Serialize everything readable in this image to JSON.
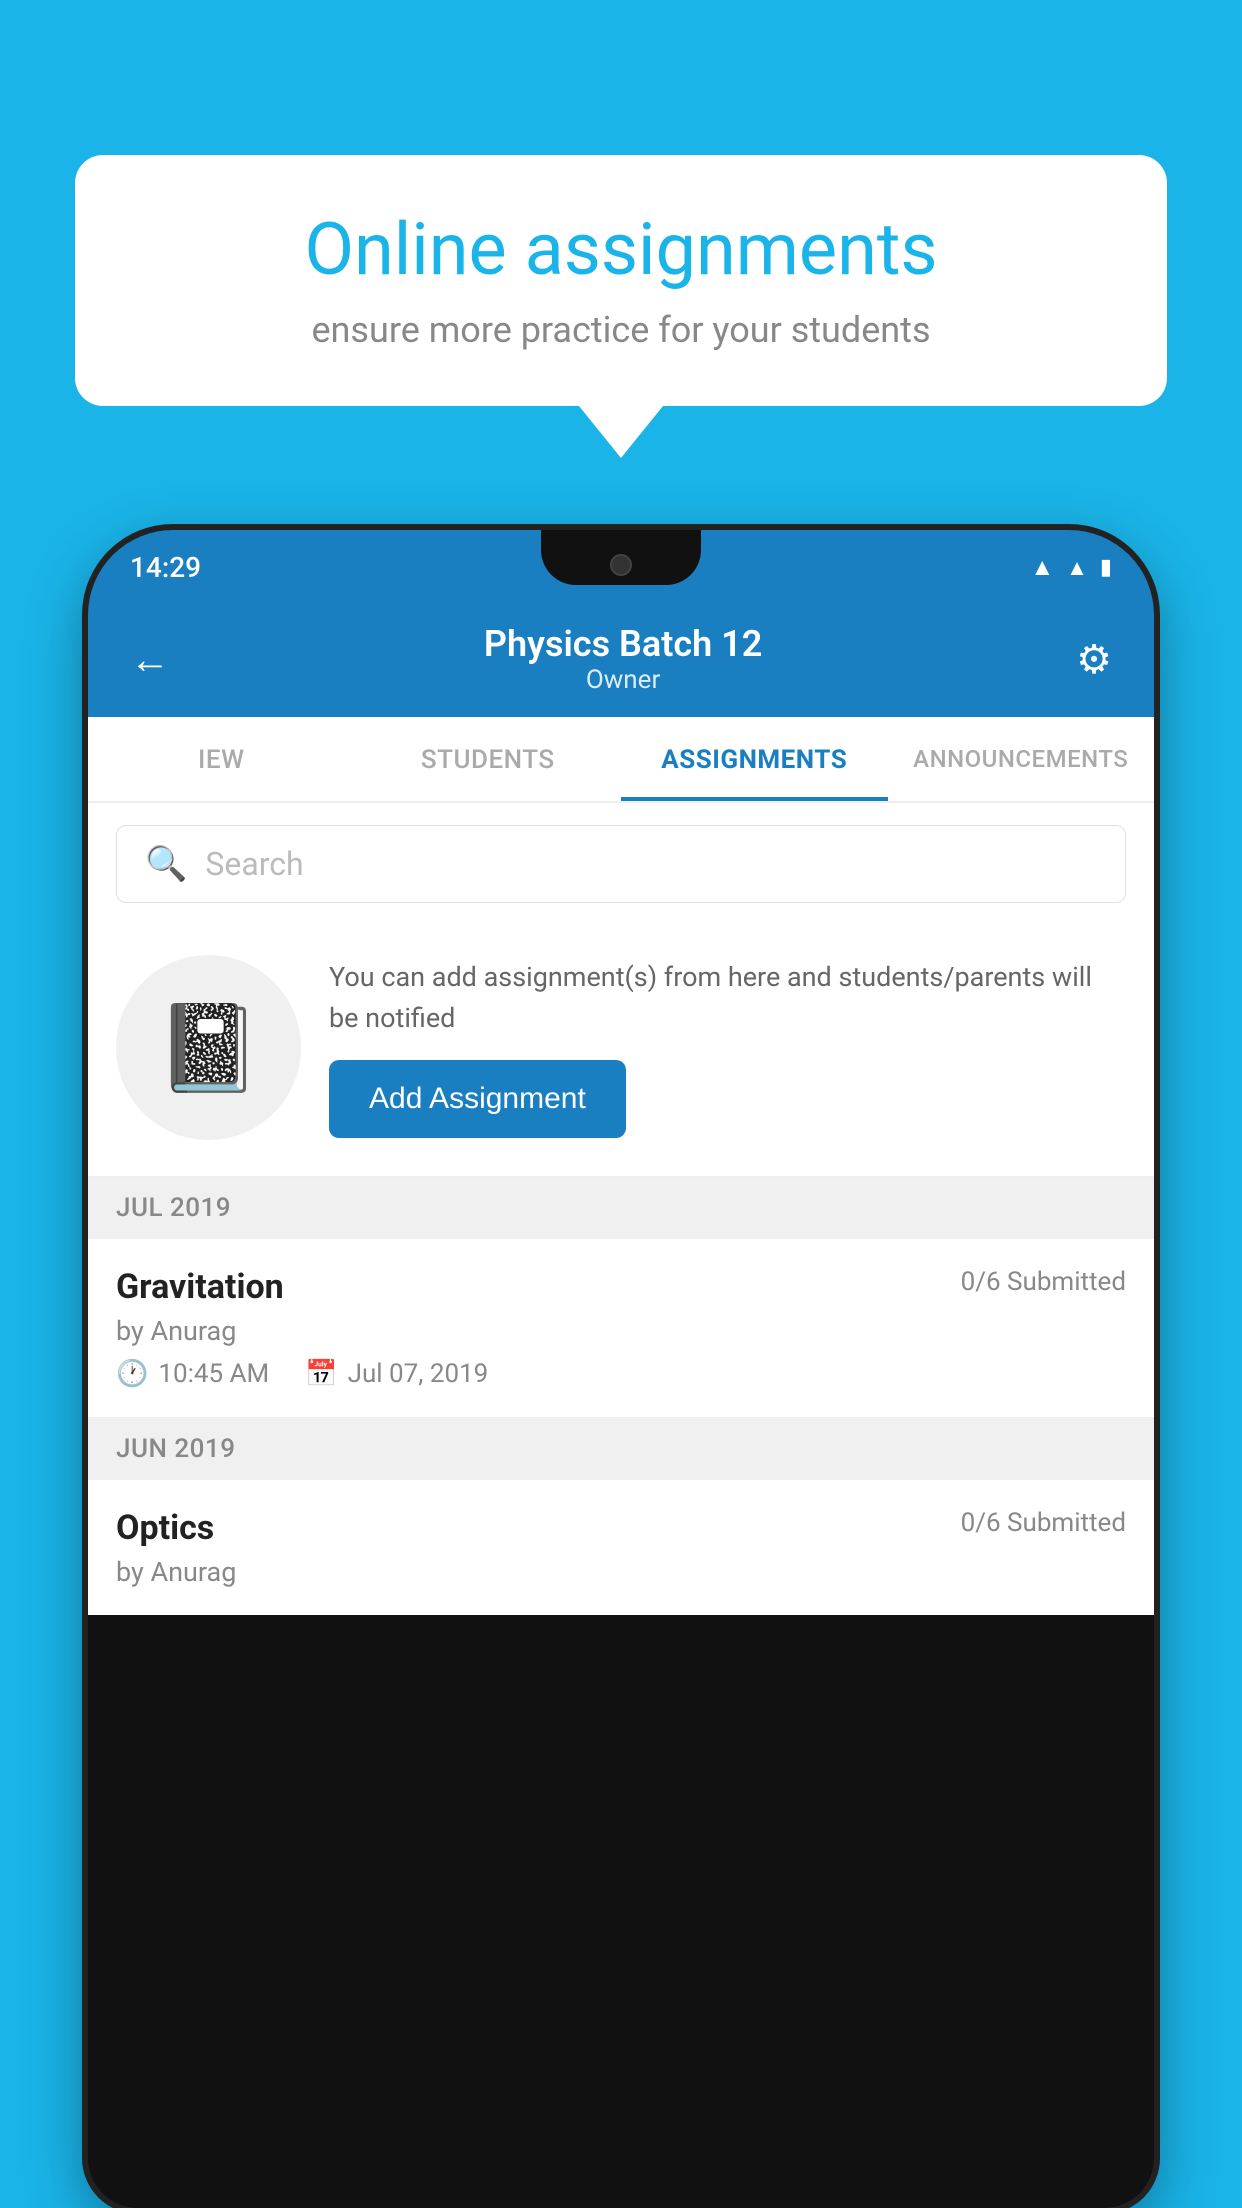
{
  "background": {
    "color": "#1ab4e8"
  },
  "speech_bubble": {
    "title": "Online assignments",
    "subtitle": "ensure more practice for your students"
  },
  "status_bar": {
    "time": "14:29",
    "icons": [
      "wifi",
      "signal",
      "battery"
    ]
  },
  "header": {
    "title": "Physics Batch 12",
    "subtitle": "Owner",
    "back_label": "←",
    "settings_icon": "⚙"
  },
  "tabs": [
    {
      "label": "IEW",
      "active": false
    },
    {
      "label": "STUDENTS",
      "active": false
    },
    {
      "label": "ASSIGNMENTS",
      "active": true
    },
    {
      "label": "ANNOUNCEMENTS",
      "active": false
    }
  ],
  "search": {
    "placeholder": "Search",
    "icon": "🔍"
  },
  "promo": {
    "description": "You can add assignment(s) from here and students/parents will be notified",
    "button_label": "Add Assignment"
  },
  "sections": [
    {
      "label": "JUL 2019",
      "assignments": [
        {
          "name": "Gravitation",
          "submitted": "0/6 Submitted",
          "by": "by Anurag",
          "time": "10:45 AM",
          "date": "Jul 07, 2019"
        }
      ]
    },
    {
      "label": "JUN 2019",
      "assignments": [
        {
          "name": "Optics",
          "submitted": "0/6 Submitted",
          "by": "by Anurag",
          "time": "",
          "date": ""
        }
      ]
    }
  ]
}
